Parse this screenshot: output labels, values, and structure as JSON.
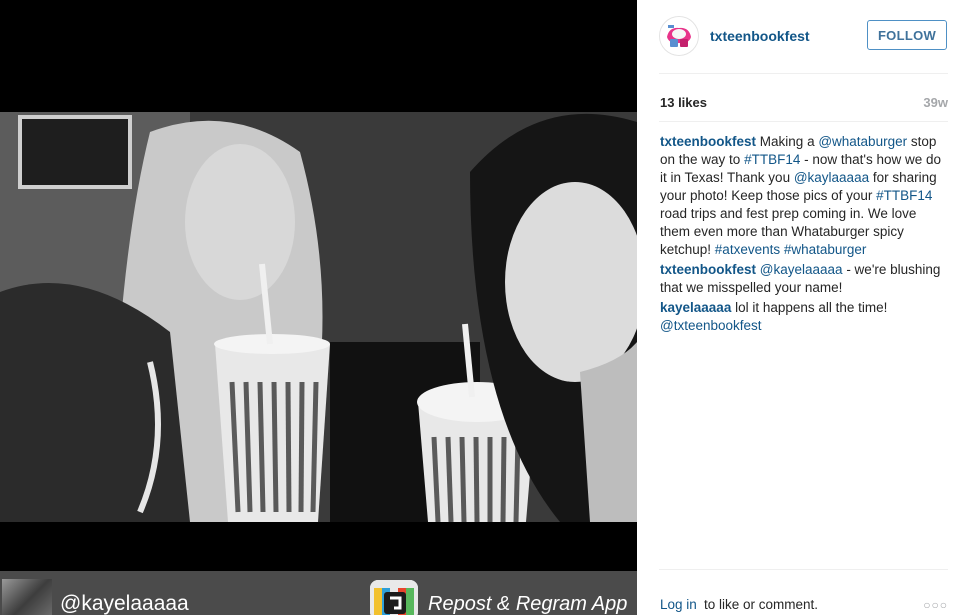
{
  "post": {
    "photo_alt": "",
    "repost": {
      "username": "@kayelaaaaa",
      "app_name": "Repost & Regram App"
    }
  },
  "header": {
    "username": "txteenbookfest",
    "follow_label": "FOLLOW",
    "avatar_icon": "txteenbookfest-logo-icon"
  },
  "stats": {
    "likes": "13 likes",
    "age": "39w"
  },
  "comments": [
    {
      "author": "txteenbookfest",
      "parts": [
        {
          "text": "Making a ",
          "tag": false
        },
        {
          "text": "@whataburger",
          "tag": true
        },
        {
          "text": " stop on the way to ",
          "tag": false
        },
        {
          "text": "#TTBF14",
          "tag": true
        },
        {
          "text": " - now that's how we do it in Texas! Thank you ",
          "tag": false
        },
        {
          "text": "@kaylaaaaa",
          "tag": true
        },
        {
          "text": " for sharing your photo! Keep those pics of your ",
          "tag": false
        },
        {
          "text": "#TTBF14",
          "tag": true
        },
        {
          "text": " road trips and fest prep coming in. We love them even more than Whataburger spicy ketchup! ",
          "tag": false
        },
        {
          "text": "#atxevents",
          "tag": true
        },
        {
          "text": " ",
          "tag": false
        },
        {
          "text": "#whataburger",
          "tag": true
        }
      ]
    },
    {
      "author": "txteenbookfest",
      "parts": [
        {
          "text": "@kayelaaaaa",
          "tag": true
        },
        {
          "text": " - we're blushing that we misspelled your name!",
          "tag": false
        }
      ]
    },
    {
      "author": "kayelaaaaa",
      "parts": [
        {
          "text": "lol it happens all the time! ",
          "tag": false
        },
        {
          "text": "@txteenbookfest",
          "tag": true
        }
      ]
    }
  ],
  "footer": {
    "login_link": "Log in",
    "login_rest": "to like or comment.",
    "more_icon": "○○○"
  },
  "colors": {
    "link": "#125688",
    "follow_border": "#4e90c5",
    "muted": "#a5a7aa"
  }
}
